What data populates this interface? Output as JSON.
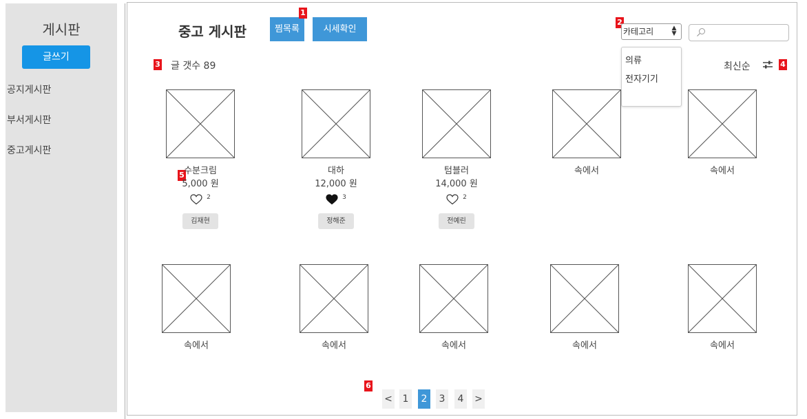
{
  "sidebar": {
    "title": "게시판",
    "write_button": "글쓰기",
    "nav": [
      "공지게시판",
      "부서게시판",
      "중고게시판"
    ]
  },
  "header": {
    "title": "중고 게시판",
    "wishlist_button": "찜목록",
    "price_check_button": "시세확인",
    "category_select": "카테고리",
    "category_options": [
      "의류",
      "전자기기"
    ]
  },
  "toolbar": {
    "post_count": "글 갯수 89",
    "sort_label": "최신순"
  },
  "markers": [
    "1",
    "2",
    "3",
    "4",
    "5",
    "6"
  ],
  "products": [
    {
      "name": "수분크림",
      "price": "5,000 원",
      "likes": "2",
      "liked": false,
      "author": "김재현"
    },
    {
      "name": "대하",
      "price": "12,000 원",
      "likes": "3",
      "liked": true,
      "author": "정해준"
    },
    {
      "name": "텀블러",
      "price": "14,000 원",
      "likes": "2",
      "liked": false,
      "author": "전예린"
    },
    {
      "name": "속에서"
    },
    {
      "name": "속에서"
    },
    {
      "name": "속에서"
    },
    {
      "name": "속에서"
    },
    {
      "name": "속에서"
    },
    {
      "name": "속에서"
    },
    {
      "name": "속에서"
    }
  ],
  "pagination": {
    "prev": "<",
    "pages": [
      "1",
      "2",
      "3",
      "4"
    ],
    "current": "2",
    "next": ">"
  },
  "colors": {
    "accent": "#1595e6",
    "button_blue": "#3f97d8",
    "marker_red": "#e8141b",
    "sidebar_bg": "#e3e3e3"
  }
}
